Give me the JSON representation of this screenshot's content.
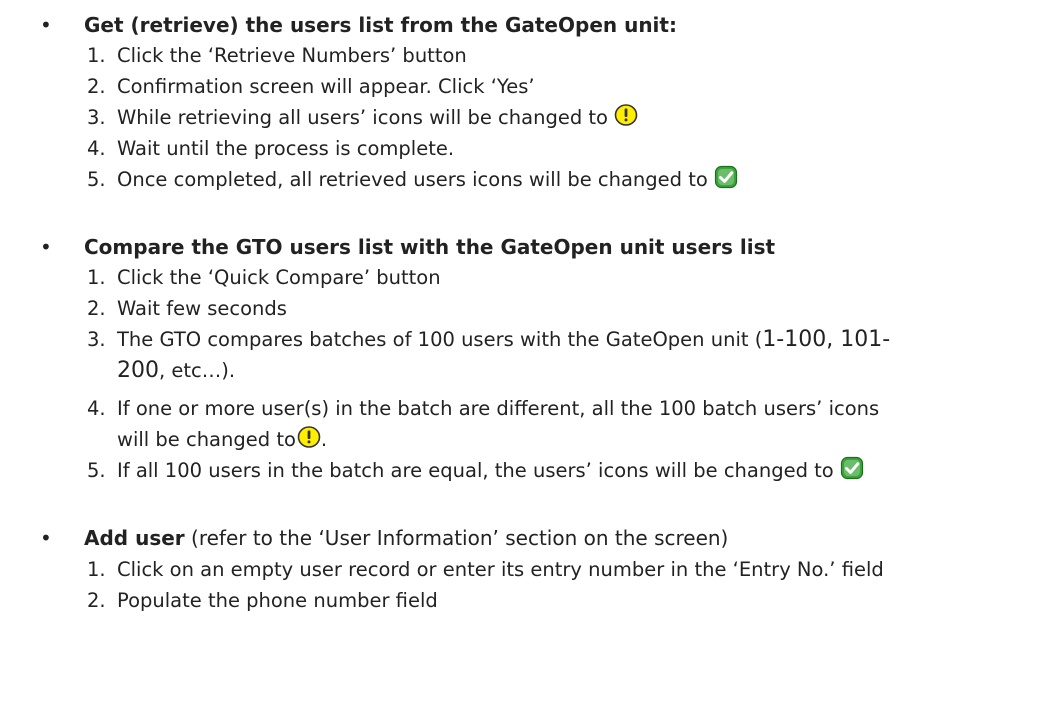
{
  "sections": [
    {
      "bullet": "•",
      "title": "Get (retrieve) the users list from the GateOpen unit:",
      "steps": [
        {
          "num": "1.",
          "text": "Click the ‘Retrieve Numbers’ button"
        },
        {
          "num": "2.",
          "text": "Confirmation screen will appear. Click ‘Yes’"
        },
        {
          "num": "3.",
          "text": "While retrieving all users’  icons will be changed to",
          "icon": "warning-icon"
        },
        {
          "num": "4.",
          "text": "Wait until the process is complete."
        },
        {
          "num": "5.",
          "text": "Once completed, all retrieved users icons will be changed to",
          "icon": "check-icon"
        }
      ]
    },
    {
      "bullet": "•",
      "title": "Compare the GTO users list with the GateOpen unit users list",
      "steps": [
        {
          "num": "1.",
          "text": "Click the ‘Quick Compare’ button"
        },
        {
          "num": "2.",
          "text": "Wait few seconds"
        },
        {
          "num": "3.",
          "text_a": "The GTO compares batches of 100 users with the GateOpen unit (",
          "text_big1": "1-100, 101-",
          "text_big2": "200",
          "text_b": ", etc…)."
        },
        {
          "num": "4.",
          "text_a": "If one or more user(s) in the batch are different, all the 100 batch users’ icons",
          "text_b": "will be changed to",
          "text_c": ".",
          "icon": "warning-icon"
        },
        {
          "num": "5.",
          "text": "If all 100 users in the batch are equal, the users’ icons will be changed to",
          "icon": "check-icon"
        }
      ]
    },
    {
      "bullet": "•",
      "title": "Add user",
      "subtitle": " (refer to the ‘User Information’ section on the screen)",
      "steps": [
        {
          "num": "1.",
          "text": "Click on an empty user record or enter its entry number in the ‘Entry No.’ field"
        },
        {
          "num": "2.",
          "text": "Populate the phone number field"
        }
      ]
    }
  ],
  "colors": {
    "warning_fill": "#ffee00",
    "warning_stroke": "#333333",
    "check_fill": "#3aa63a",
    "check_mark": "#ffffff",
    "text": "#222222"
  }
}
